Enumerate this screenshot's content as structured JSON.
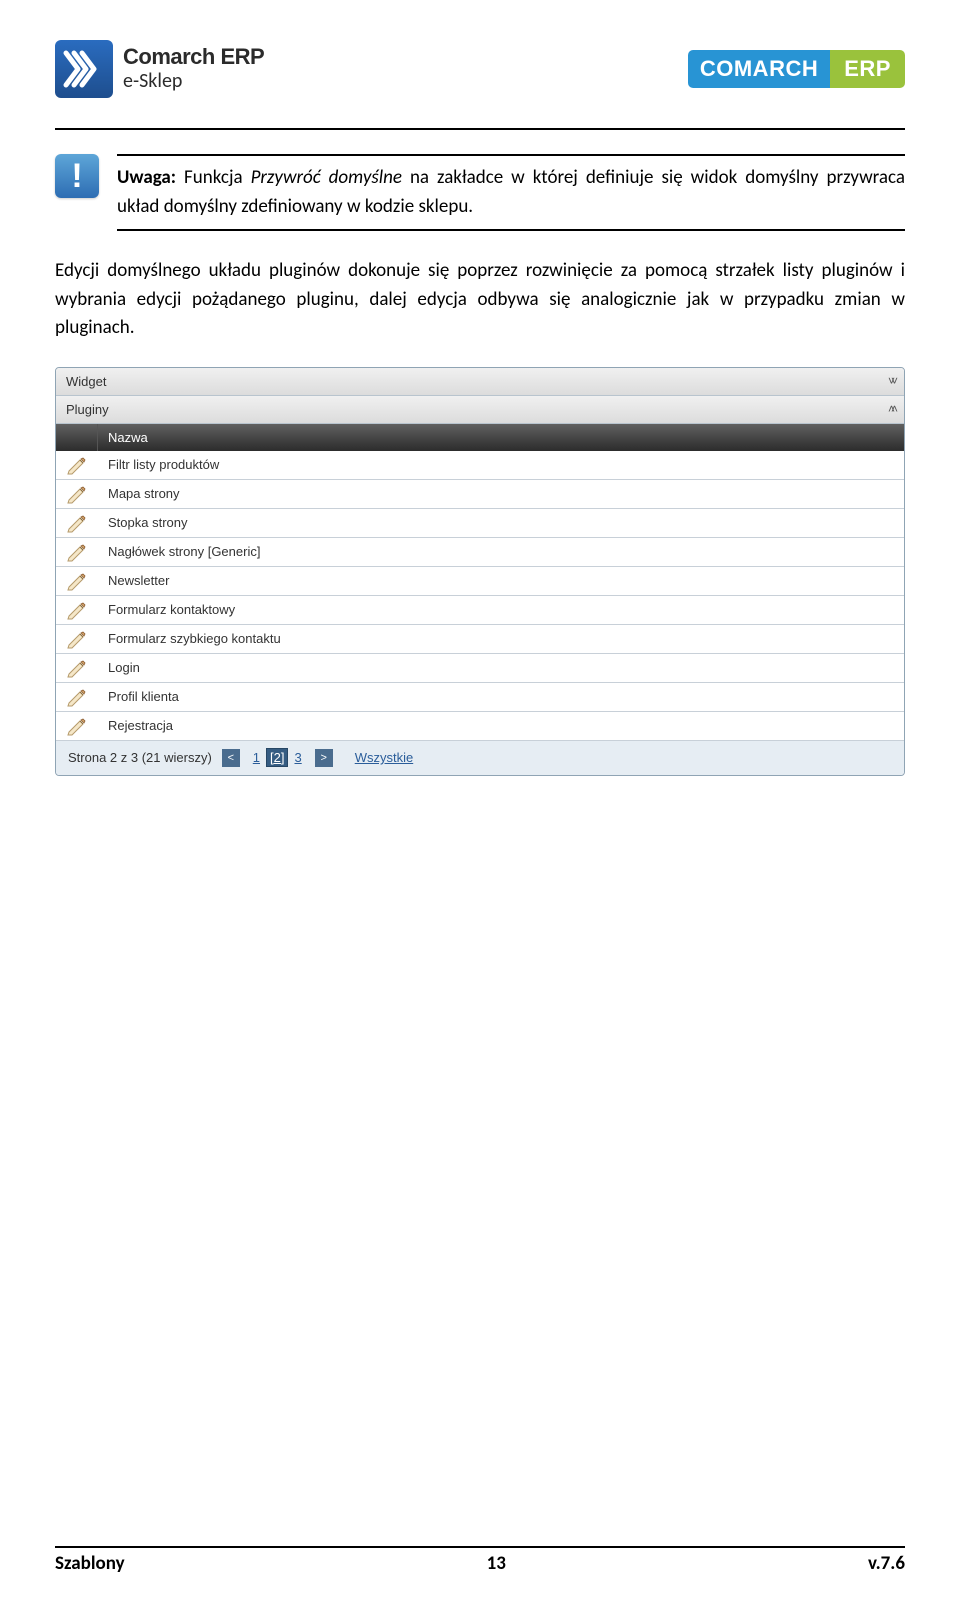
{
  "header": {
    "brand_line1": "Comarch ERP",
    "brand_line2": "e-Sklep",
    "badge_left": "COMARCH",
    "badge_right": "ERP"
  },
  "note": {
    "label": "Uwaga:",
    "prefix": "Funkcja ",
    "italic": "Przywróć domyślne",
    "rest": " na zakładce w której definiuje się widok domyślny przywraca układ domyślny zdefiniowany w kodzie sklepu."
  },
  "paragraph": "Edycji domyślnego układu pluginów dokonuje się poprzez rozwinięcie za pomocą strzałek listy pluginów i wybrania edycji pożądanego pluginu, dalej edycja odbywa się analogicznie jak w przypadku zmian w pluginach.",
  "panel": {
    "section_widget": "Widget",
    "section_plugins": "Pluginy",
    "column_name": "Nazwa",
    "rows": [
      "Filtr listy produktów",
      "Mapa strony",
      "Stopka strony",
      "Nagłówek strony [Generic]",
      "Newsletter",
      "Formularz kontaktowy",
      "Formularz szybkiego kontaktu",
      "Login",
      "Profil klienta",
      "Rejestracja"
    ],
    "pager": {
      "summary": "Strona 2 z 3 (21 wierszy)",
      "pages": [
        "1",
        "[2]",
        "3"
      ],
      "all": "Wszystkie"
    }
  },
  "footer": {
    "left": "Szablony",
    "center": "13",
    "right": "v.7.6"
  }
}
